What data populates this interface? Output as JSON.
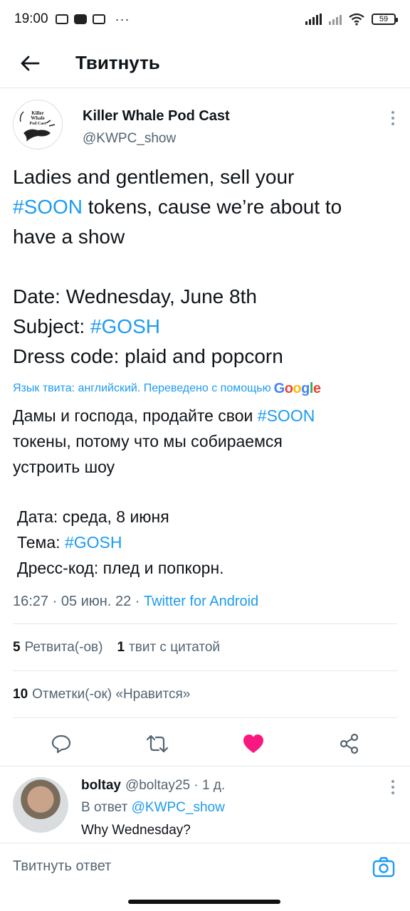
{
  "status_bar": {
    "time": "19:00",
    "dots": "···",
    "battery": "59"
  },
  "header": {
    "title": "Твитнуть"
  },
  "tweet": {
    "author_name": "Killer Whale Pod Cast",
    "author_handle": "@KWPC_show",
    "avatar_text": [
      "Killer",
      "Whale",
      "Pod Cast"
    ],
    "text": {
      "line1_a": "Ladies and gentlemen, sell your",
      "tag1": "#SOON",
      "line2_b": " tokens, cause we’re about to",
      "line3": "have a show",
      "date": "Date: Wednesday, June 8th",
      "subject_label": "Subject: ",
      "tag2": "#GOSH",
      "dress": "Dress code: plaid and popcorn"
    },
    "translation_meta": "Язык твита: английский. Переведено с помощью",
    "google_logo": [
      "G",
      "o",
      "o",
      "g",
      "l",
      "e"
    ],
    "translated": {
      "line1_a": "Дамы и господа, продайте свои ",
      "tag1": "#SOON",
      "line2": "токены, потому что мы собираемся",
      "line3": "устроить шоу",
      "date": "Дата: среда, 8 июня",
      "topic_label": "Тема: ",
      "tag2": "#GOSH",
      "dress": "Дресс-код: плед и попкорн."
    },
    "timestamp": "16:27 · 05 июн. 22 · ",
    "source": "Twitter for Android",
    "stats": {
      "retweets_count": "5",
      "retweets_label": "Ретвита(-ов)",
      "quotes_count": "1",
      "quotes_label": "твит с цитатой",
      "likes_count": "10",
      "likes_label": "Отметки(-ок) «Нравится»"
    },
    "liked": true,
    "colors": {
      "accent": "#1d9bf0",
      "like": "#f91880",
      "text": "#0f1419",
      "secondary": "#536471"
    }
  },
  "reply": {
    "name": "boltay",
    "handle_time": "@boltay25 · 1 д.",
    "reply_to_label": "В ответ ",
    "reply_to_handle": "@KWPC_show",
    "text": "Why Wednesday?"
  },
  "compose": {
    "placeholder": "Твитнуть ответ"
  },
  "icons": {
    "back": "arrow-left-icon",
    "reply": "comment-icon",
    "retweet": "retweet-icon",
    "like": "heart-icon",
    "share": "share-icon",
    "camera": "camera-icon",
    "more": "vertical-dots-icon"
  }
}
